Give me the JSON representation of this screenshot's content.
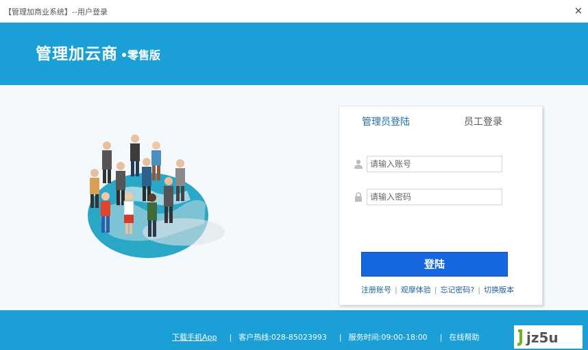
{
  "window": {
    "title": "【管理加商业系统】--用户登录",
    "close_glyph": "✕"
  },
  "brand": {
    "name": "管理加云商",
    "edition": "零售版"
  },
  "login": {
    "tabs": [
      {
        "label": "管理员登陆",
        "active": true
      },
      {
        "label": "员工登录",
        "active": false
      }
    ],
    "account_placeholder": "请输入账号",
    "password_placeholder": "请输入密码",
    "login_button": "登陆",
    "links": [
      "注册账号",
      "观摩体验",
      "忘记密码?",
      "切换版本"
    ]
  },
  "footer": {
    "download_app": "下载手机App",
    "hotline": "客户热线:028-85023993",
    "service_hours": "服务时间:09:00-18:00",
    "online_help": "在线帮助"
  },
  "watermark": {
    "text": "jz5u"
  },
  "colors": {
    "banner": "#1aa0d6",
    "content_bg": "#f3f9fc",
    "login_button": "#1668e0",
    "tab_active": "#1f6ea8"
  },
  "icons": {
    "user_field": "user-icon",
    "password_field": "lock-icon",
    "close": "close-icon"
  }
}
